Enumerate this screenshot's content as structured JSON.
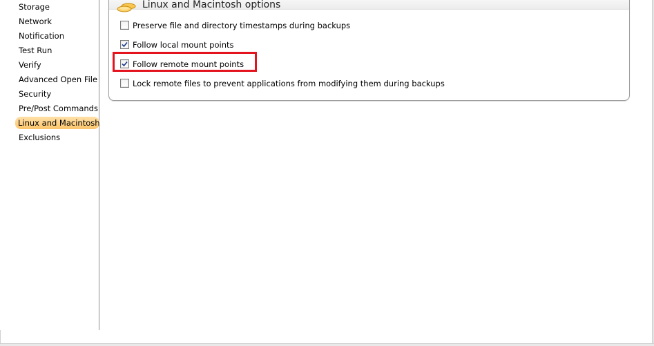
{
  "sidebar": {
    "items": [
      {
        "label": "Storage"
      },
      {
        "label": "Network"
      },
      {
        "label": "Notification"
      },
      {
        "label": "Test Run"
      },
      {
        "label": "Verify"
      },
      {
        "label": "Advanced Open File"
      },
      {
        "label": "Security"
      },
      {
        "label": "Pre/Post Commands"
      },
      {
        "label": "Linux and Macintosh",
        "selected": true
      },
      {
        "label": "Exclusions"
      }
    ]
  },
  "panel": {
    "title": "Linux and Macintosh options",
    "icon": "database-icon",
    "options": [
      {
        "label": "Preserve file and directory timestamps during backups",
        "checked": false
      },
      {
        "label": "Follow local mount points",
        "checked": true
      },
      {
        "label": "Follow remote mount points",
        "checked": true,
        "highlighted": true
      },
      {
        "label": "Lock remote files to prevent applications from modifying them during backups",
        "checked": false
      }
    ]
  },
  "colors": {
    "selection": "#fcc56a",
    "highlight_border": "#e3141e",
    "panel_border": "#9e9e9e"
  }
}
